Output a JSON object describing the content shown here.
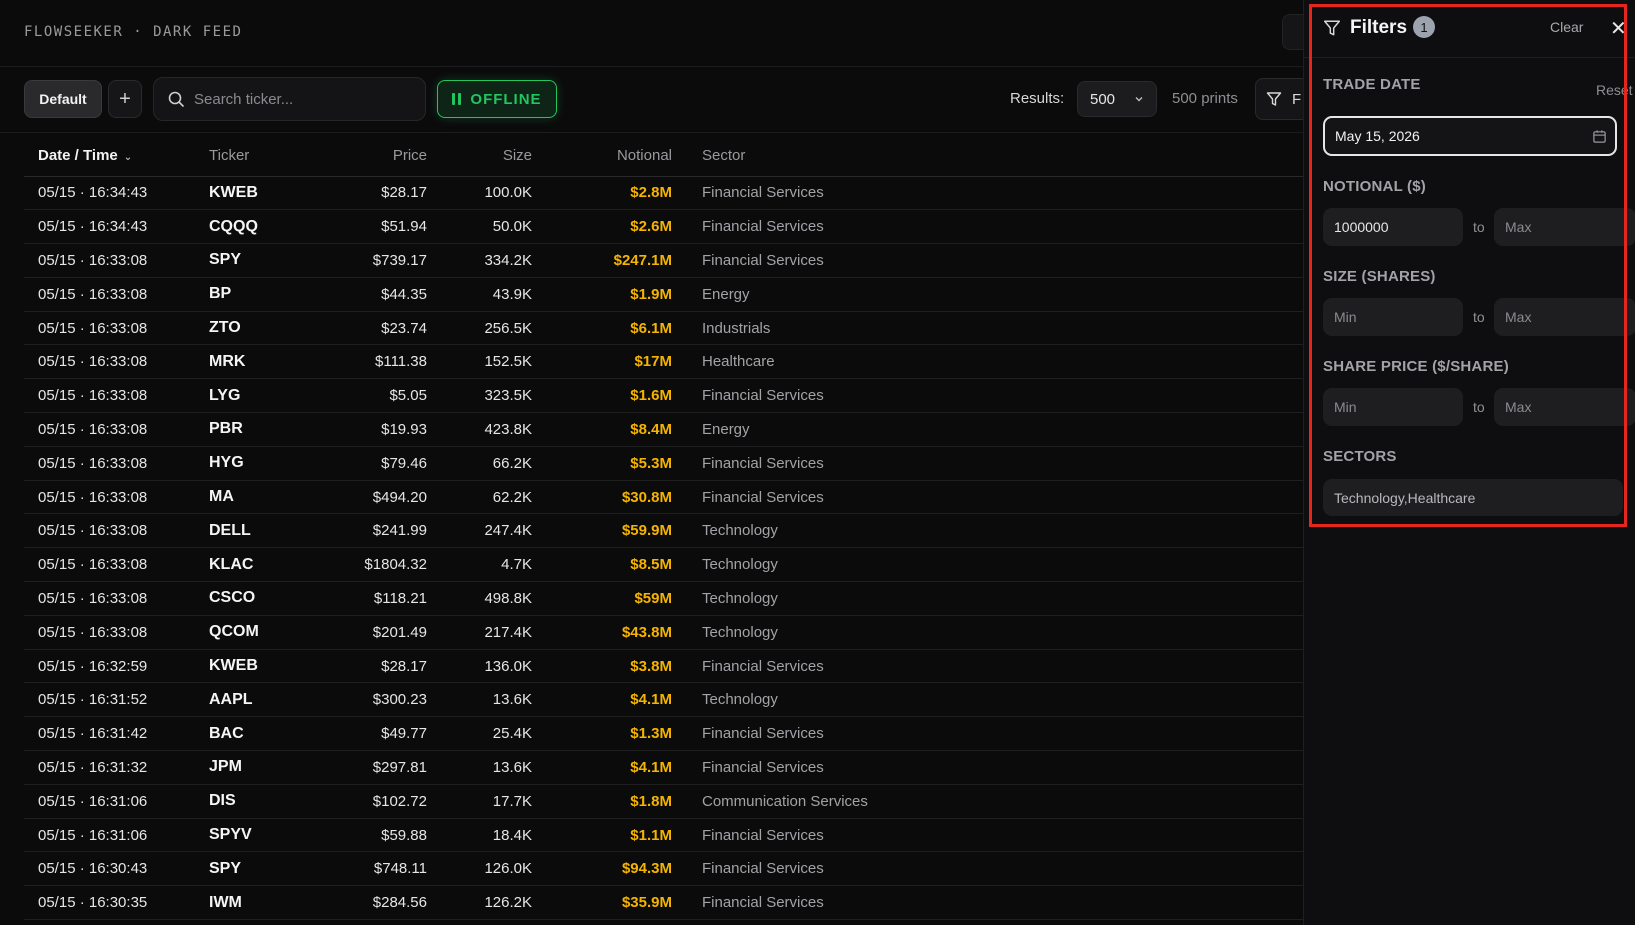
{
  "header": {
    "brand": "FLOWSEEKER · DARK FEED"
  },
  "toolbar": {
    "default_label": "Default",
    "add_label": "+",
    "search_placeholder": "Search ticker...",
    "offline_label": "OFFLINE",
    "results_label": "Results:",
    "results_value": "500",
    "prints_count": "500 prints",
    "filter_peek_label": "F"
  },
  "table": {
    "columns": [
      "Date / Time",
      "Ticker",
      "Price",
      "Size",
      "Notional",
      "Sector"
    ],
    "rows": [
      [
        "05/15 · 16:34:43",
        "KWEB",
        "$28.17",
        "100.0K",
        "$2.8M",
        "Financial Services"
      ],
      [
        "05/15 · 16:34:43",
        "CQQQ",
        "$51.94",
        "50.0K",
        "$2.6M",
        "Financial Services"
      ],
      [
        "05/15 · 16:33:08",
        "SPY",
        "$739.17",
        "334.2K",
        "$247.1M",
        "Financial Services"
      ],
      [
        "05/15 · 16:33:08",
        "BP",
        "$44.35",
        "43.9K",
        "$1.9M",
        "Energy"
      ],
      [
        "05/15 · 16:33:08",
        "ZTO",
        "$23.74",
        "256.5K",
        "$6.1M",
        "Industrials"
      ],
      [
        "05/15 · 16:33:08",
        "MRK",
        "$111.38",
        "152.5K",
        "$17M",
        "Healthcare"
      ],
      [
        "05/15 · 16:33:08",
        "LYG",
        "$5.05",
        "323.5K",
        "$1.6M",
        "Financial Services"
      ],
      [
        "05/15 · 16:33:08",
        "PBR",
        "$19.93",
        "423.8K",
        "$8.4M",
        "Energy"
      ],
      [
        "05/15 · 16:33:08",
        "HYG",
        "$79.46",
        "66.2K",
        "$5.3M",
        "Financial Services"
      ],
      [
        "05/15 · 16:33:08",
        "MA",
        "$494.20",
        "62.2K",
        "$30.8M",
        "Financial Services"
      ],
      [
        "05/15 · 16:33:08",
        "DELL",
        "$241.99",
        "247.4K",
        "$59.9M",
        "Technology"
      ],
      [
        "05/15 · 16:33:08",
        "KLAC",
        "$1804.32",
        "4.7K",
        "$8.5M",
        "Technology"
      ],
      [
        "05/15 · 16:33:08",
        "CSCO",
        "$118.21",
        "498.8K",
        "$59M",
        "Technology"
      ],
      [
        "05/15 · 16:33:08",
        "QCOM",
        "$201.49",
        "217.4K",
        "$43.8M",
        "Technology"
      ],
      [
        "05/15 · 16:32:59",
        "KWEB",
        "$28.17",
        "136.0K",
        "$3.8M",
        "Financial Services"
      ],
      [
        "05/15 · 16:31:52",
        "AAPL",
        "$300.23",
        "13.6K",
        "$4.1M",
        "Technology"
      ],
      [
        "05/15 · 16:31:42",
        "BAC",
        "$49.77",
        "25.4K",
        "$1.3M",
        "Financial Services"
      ],
      [
        "05/15 · 16:31:32",
        "JPM",
        "$297.81",
        "13.6K",
        "$4.1M",
        "Financial Services"
      ],
      [
        "05/15 · 16:31:06",
        "DIS",
        "$102.72",
        "17.7K",
        "$1.8M",
        "Communication Services"
      ],
      [
        "05/15 · 16:31:06",
        "SPYV",
        "$59.88",
        "18.4K",
        "$1.1M",
        "Financial Services"
      ],
      [
        "05/15 · 16:30:43",
        "SPY",
        "$748.11",
        "126.0K",
        "$94.3M",
        "Financial Services"
      ],
      [
        "05/15 · 16:30:35",
        "IWM",
        "$284.56",
        "126.2K",
        "$35.9M",
        "Financial Services"
      ]
    ]
  },
  "filters": {
    "title": "Filters",
    "badge": "1",
    "clear_label": "Clear",
    "trade_date_label": "TRADE DATE",
    "reset_label": "Reset",
    "trade_date_value": "May 15, 2026",
    "notional_label": "NOTIONAL ($)",
    "notional_min": "1000000",
    "notional_max_placeholder": "Max",
    "size_label": "SIZE (SHARES)",
    "size_min_placeholder": "Min",
    "size_max_placeholder": "Max",
    "price_label": "SHARE PRICE ($/SHARE)",
    "price_min_placeholder": "Min",
    "price_max_placeholder": "Max",
    "sectors_label": "SECTORS",
    "sectors_value": "Technology,Healthcare",
    "to_label": "to"
  },
  "colors": {
    "accent_green": "#22c55e",
    "notional_gold": "#f5b400",
    "highlight_red": "#e5261e"
  }
}
